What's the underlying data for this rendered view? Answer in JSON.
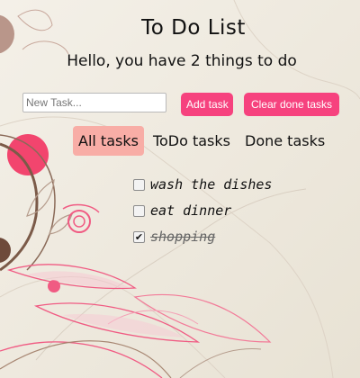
{
  "header": {
    "title": "To Do List",
    "subtitle": "Hello, you have 2 things to do"
  },
  "toolbar": {
    "task_input_value": "",
    "task_input_placeholder": "New Task...",
    "add_label": "Add task",
    "clear_label": "Clear done tasks"
  },
  "tabs": [
    {
      "label": "All tasks",
      "active": true
    },
    {
      "label": "ToDo tasks",
      "active": false
    },
    {
      "label": "Done tasks",
      "active": false
    }
  ],
  "tasks": [
    {
      "text": "wash the dishes",
      "done": false
    },
    {
      "text": "eat dinner",
      "done": false
    },
    {
      "text": "shopping",
      "done": true
    }
  ],
  "colors": {
    "accent": "#f6427e",
    "active_tab": "#f8ada6",
    "background": "#ece8de"
  },
  "icons": {
    "checkbox": "checkbox-icon",
    "checkmark": "checkmark-icon"
  }
}
